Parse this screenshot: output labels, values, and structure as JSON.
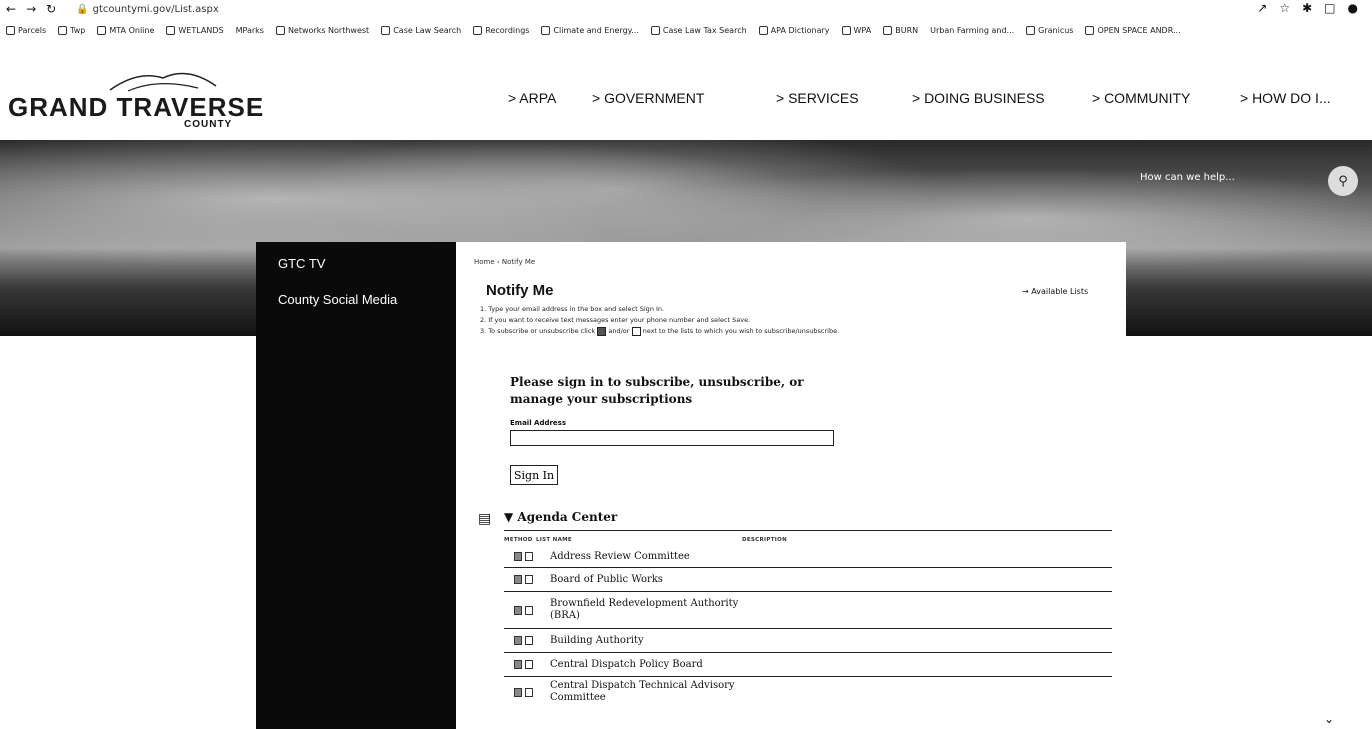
{
  "browser": {
    "url": "gtcountymi.gov/List.aspx",
    "bookmarks": [
      "Parcels",
      "Twp",
      "MTA Online",
      "WETLANDS",
      "MParks",
      "Networks Northwest",
      "Case Law Search",
      "Recordings",
      "Climate and Energy...",
      "Case Law Tax Search",
      "APA Dictionary",
      "WPA",
      "BURN",
      "Urban Farming and...",
      "Granicus",
      "OPEN SPACE ANDR..."
    ]
  },
  "header": {
    "logo_word": "GRAND TRAVERSE",
    "logo_sub": "COUNTY",
    "nav": [
      "> ARPA",
      "> GOVERNMENT",
      "> SERVICES",
      "> DOING BUSINESS",
      "> COMMUNITY",
      "> HOW DO I..."
    ]
  },
  "search": {
    "placeholder": "How can we help..."
  },
  "sidebar": {
    "items": [
      "GTC TV",
      "County Social Media"
    ]
  },
  "content": {
    "breadcrumb": "Home › Notify Me",
    "title": "Notify Me",
    "available_lists": "→ Available Lists",
    "step1": "1. Type your email address in the box and select Sign In.",
    "step2": "2. If you want to receive text messages enter your phone number and select Save.",
    "step3a": "3. To subscribe or unsubscribe click",
    "step3b": "and/or",
    "step3c": "next to the lists to which you wish to subscribe/unsubscribe.",
    "signin_heading": "Please sign in to subscribe, unsubscribe, or manage your subscriptions",
    "email_label": "Email Address",
    "email_value": "",
    "signin_button": "Sign In",
    "agenda_title": "▼ Agenda Center",
    "columns": [
      "METHOD",
      "LIST NAME",
      "DESCRIPTION"
    ],
    "rows": [
      {
        "name": "Address Review Committee"
      },
      {
        "name": "Board of Public Works"
      },
      {
        "name": "Brownfield Redevelopment Authority (BRA)"
      },
      {
        "name": "Building Authority"
      },
      {
        "name": "Central Dispatch Policy Board"
      },
      {
        "name": "Central Dispatch Technical Advisory Committee"
      }
    ]
  }
}
